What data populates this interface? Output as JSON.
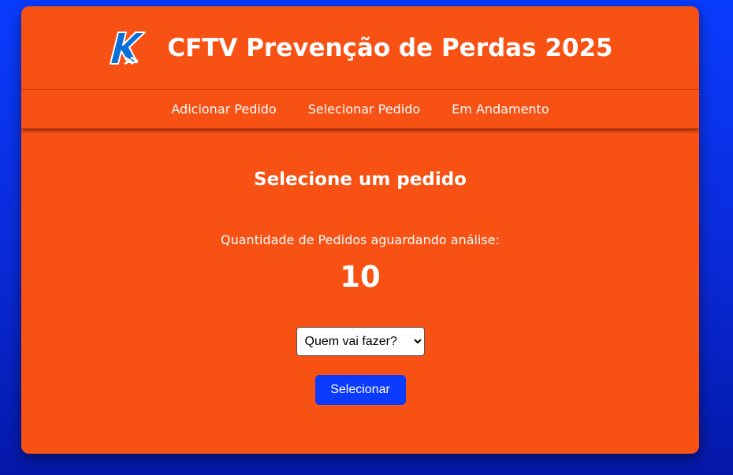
{
  "header": {
    "title": "CFTV Prevenção de Perdas 2025",
    "logo_icon": "k-brand-logo-icon"
  },
  "nav": {
    "items": [
      {
        "label": "Adicionar Pedido"
      },
      {
        "label": "Selecionar Pedido"
      },
      {
        "label": "Em Andamento"
      }
    ]
  },
  "main": {
    "heading": "Selecione um pedido",
    "count_label": "Quantidade de Pedidos aguardando análise:",
    "count_value": "10",
    "select": {
      "selected": "Quem vai fazer?"
    },
    "submit_label": "Selecionar"
  },
  "colors": {
    "background": "#0a3cff",
    "card": "#f85114",
    "button": "#0b3bff",
    "logo_blue": "#0a6fd6"
  }
}
